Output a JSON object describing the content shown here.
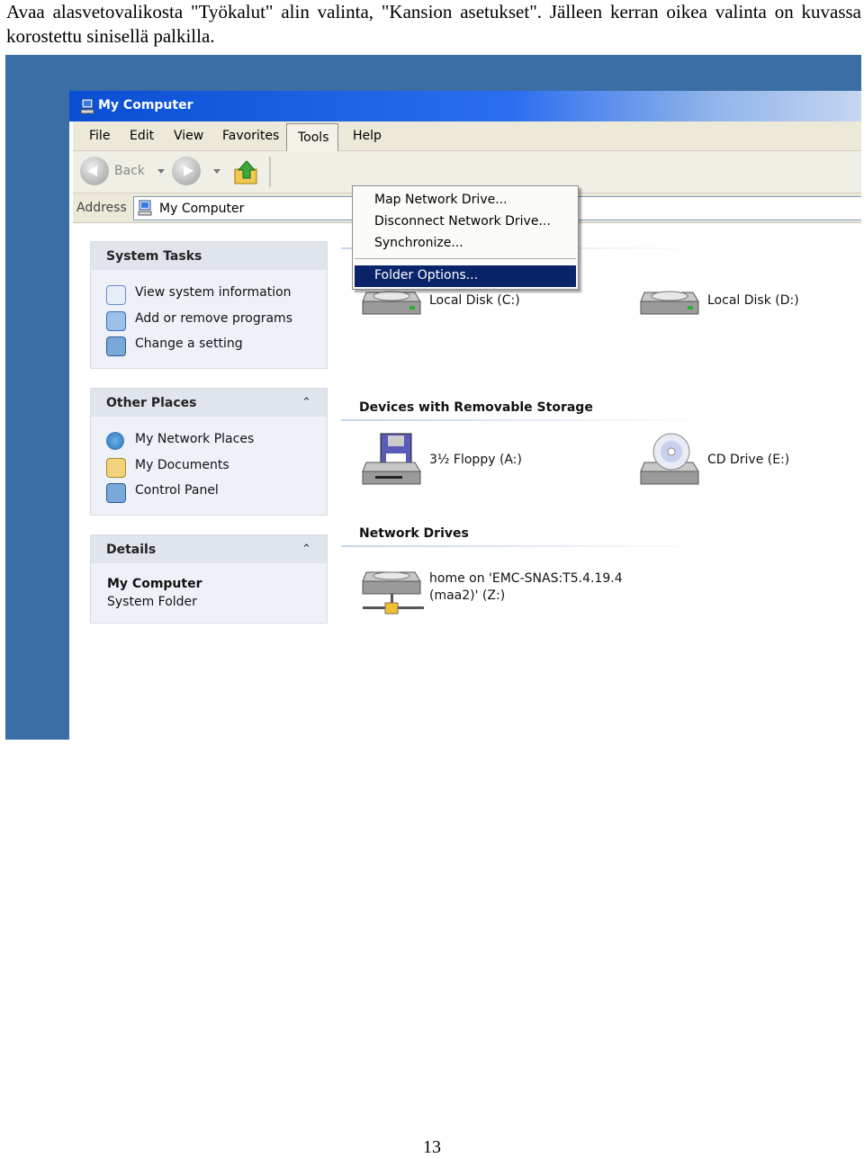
{
  "intro_text": "Avaa alasvetovalikosta \"Työkalut\" alin valinta, \"Kansion asetukset\". Jälleen kerran oikea valinta on kuvassa korostettu sinisellä palkilla.",
  "page_number": "13",
  "window": {
    "title": "My Computer",
    "menus": [
      "File",
      "Edit",
      "View",
      "Favorites",
      "Tools",
      "Help"
    ],
    "toolbar": {
      "back_label": "Back"
    },
    "address": {
      "label": "Address",
      "value": "My Computer"
    }
  },
  "tools_menu": {
    "items": [
      "Map Network Drive...",
      "Disconnect Network Drive...",
      "Synchronize..."
    ],
    "highlighted": "Folder Options..."
  },
  "panels": {
    "system_tasks": {
      "title": "System Tasks",
      "items": [
        "View system information",
        "Add or remove programs",
        "Change a setting"
      ]
    },
    "other_places": {
      "title": "Other Places",
      "items": [
        "My Network Places",
        "My Documents",
        "Control Panel"
      ]
    },
    "details": {
      "title": "Details",
      "name": "My Computer",
      "type": "System Folder"
    }
  },
  "drives": {
    "hard_disks": [
      "Local Disk (C:)",
      "Local Disk (D:)"
    ],
    "removable_title": "Devices with Removable Storage",
    "removable": [
      "3½ Floppy (A:)",
      "CD Drive (E:)"
    ],
    "network_title": "Network Drives",
    "network": [
      "home on 'EMC-SNAS:T5.4.19.4",
      "(maa2)' (Z:)"
    ]
  },
  "colors": {
    "desktop": "#3a6ea5",
    "titlebar": "#0a4fd3",
    "highlight": "#0a246a"
  }
}
